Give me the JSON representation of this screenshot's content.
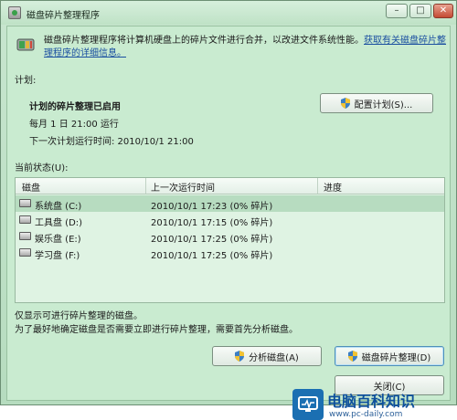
{
  "window": {
    "title": "磁盘碎片整理程序"
  },
  "titlebar_controls": {
    "minimize": "–",
    "maximize": "□",
    "close": "✕"
  },
  "intro": {
    "text": "磁盘碎片整理程序将计算机硬盘上的碎片文件进行合并，以改进文件系统性能。",
    "link": "获取有关磁盘碎片整理程序的详细信息。"
  },
  "schedule": {
    "section_label": "计划:",
    "status": "计划的碎片整理已启用",
    "frequency": "每月 1 日 21:00 运行",
    "next_run": "下一次计划运行时间: 2010/10/1 21:00",
    "config_button": "配置计划(S)..."
  },
  "status_section": {
    "label": "当前状态(U):",
    "columns": [
      "磁盘",
      "上一次运行时间",
      "进度"
    ],
    "rows": [
      {
        "disk": "系统盘 (C:)",
        "last_run": "2010/10/1 17:23 (0% 碎片)",
        "progress": ""
      },
      {
        "disk": "工具盘 (D:)",
        "last_run": "2010/10/1 17:15 (0% 碎片)",
        "progress": ""
      },
      {
        "disk": "娱乐盘 (E:)",
        "last_run": "2010/10/1 17:25 (0% 碎片)",
        "progress": ""
      },
      {
        "disk": "学习盘 (F:)",
        "last_run": "2010/10/1 17:25 (0% 碎片)",
        "progress": ""
      }
    ]
  },
  "notes": {
    "line1": "仅显示可进行碎片整理的磁盘。",
    "line2": "为了最好地确定磁盘是否需要立即进行碎片整理，需要首先分析磁盘。"
  },
  "buttons": {
    "analyze": "分析磁盘(A)",
    "defrag": "磁盘碎片整理(D)",
    "close": "关闭(C)"
  },
  "watermark": {
    "text": "电脑百科知识",
    "url": "www.pc-daily.com"
  },
  "colors": {
    "accent": "#1a4fa0",
    "window_bg": "#c9ebd0",
    "link": "#1a4fa0"
  }
}
